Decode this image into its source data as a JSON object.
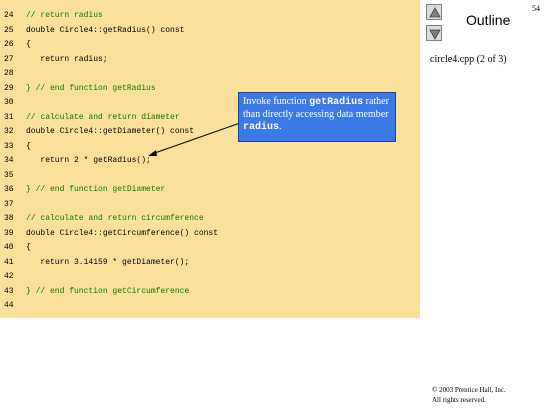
{
  "slide": {
    "page_number": "54",
    "outline_title": "Outline",
    "file_label": "circle4.cpp (2 of 3)",
    "copyright_line1": "© 2003 Prentice Hall, Inc.",
    "copyright_line2": "All rights reserved."
  },
  "nav": {
    "up_icon": "triangle-up-icon",
    "down_icon": "triangle-down-icon"
  },
  "callout": {
    "text_before": "Invoke function ",
    "code1": "getRadius",
    "text_middle": " rather than directly accessing data member ",
    "code2": "radius",
    "text_after": "."
  },
  "code": {
    "lines": [
      {
        "num": "24",
        "text": "// return radius"
      },
      {
        "num": "25",
        "text": "double Circle4::getRadius() const"
      },
      {
        "num": "26",
        "text": "{"
      },
      {
        "num": "27",
        "text": "   return radius;"
      },
      {
        "num": "28",
        "text": ""
      },
      {
        "num": "29",
        "text": "} // end function getRadius"
      },
      {
        "num": "30",
        "text": ""
      },
      {
        "num": "31",
        "text": "// calculate and return diameter"
      },
      {
        "num": "32",
        "text": "double Circle4::getDiameter() const"
      },
      {
        "num": "33",
        "text": "{"
      },
      {
        "num": "34",
        "text": "   return 2 * getRadius();"
      },
      {
        "num": "35",
        "text": ""
      },
      {
        "num": "36",
        "text": "} // end function getDiameter"
      },
      {
        "num": "37",
        "text": ""
      },
      {
        "num": "38",
        "text": "// calculate and return circumference"
      },
      {
        "num": "39",
        "text": "double Circle4::getCircumference() const"
      },
      {
        "num": "40",
        "text": "{"
      },
      {
        "num": "41",
        "text": "   return 3.14159 * getDiameter();"
      },
      {
        "num": "42",
        "text": ""
      },
      {
        "num": "43",
        "text": "} // end function getCircumference"
      },
      {
        "num": "44",
        "text": ""
      }
    ]
  },
  "colors": {
    "code_background": "#fbe09b",
    "callout_background": "#3b79e6",
    "comment": "#008000",
    "keyword": "#000080"
  }
}
